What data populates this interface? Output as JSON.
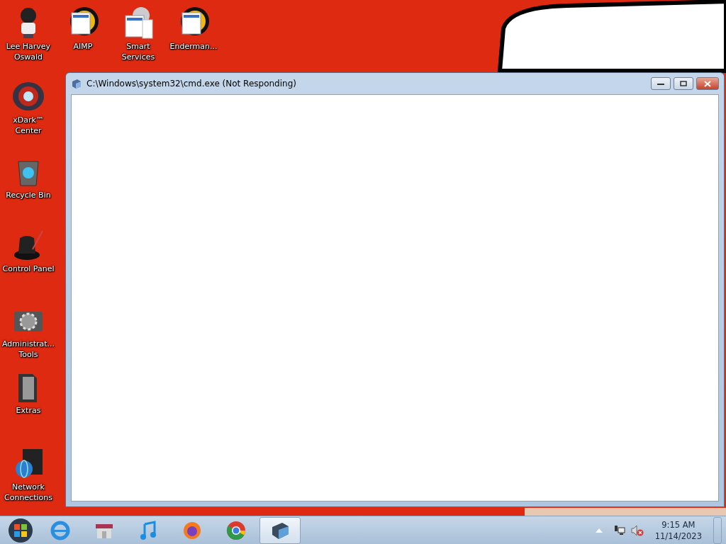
{
  "desktop_icons": [
    {
      "label": "Lee Harvey Oswald",
      "kind": "figure"
    },
    {
      "label": "AIMP",
      "kind": "app"
    },
    {
      "label": "Smart Services",
      "kind": "gearapp"
    },
    {
      "label": "Enderman...",
      "kind": "app"
    },
    {
      "label": "xDark™ Center",
      "kind": "ring"
    },
    {
      "label": "Recycle Bin",
      "kind": "bin"
    },
    {
      "label": "Control Panel",
      "kind": "hat"
    },
    {
      "label": "Administrat... Tools",
      "kind": "gear"
    },
    {
      "label": "Extras",
      "kind": "folder"
    },
    {
      "label": "Network Connections",
      "kind": "globe"
    }
  ],
  "window": {
    "title": "C:\\Windows\\system32\\cmd.exe (Not Responding)"
  },
  "taskbar": {
    "items": [
      {
        "kind": "ie",
        "selected": false
      },
      {
        "kind": "store",
        "selected": false
      },
      {
        "kind": "music",
        "selected": false
      },
      {
        "kind": "firefox",
        "selected": false
      },
      {
        "kind": "chrome",
        "selected": false
      },
      {
        "kind": "cmd",
        "selected": true
      }
    ],
    "clock": {
      "time": "9:15 AM",
      "date": "11/14/2023"
    }
  }
}
